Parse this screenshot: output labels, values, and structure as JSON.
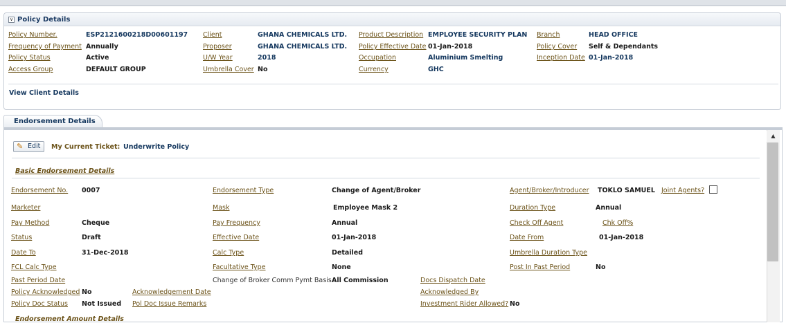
{
  "policy": {
    "title": "Policy Details",
    "labels": {
      "number": "Policy Number.",
      "frequency": "Frequency of Payment",
      "status": "Policy Status",
      "access_group": "Access Group",
      "client": "Client",
      "proposer": "Proposer",
      "uw_year": "U/W Year",
      "umbrella_cover": "Umbrella Cover",
      "product": "Product Description",
      "effective_date": "Policy Effective Date",
      "occupation": "Occupation",
      "currency": "Currency",
      "branch": "Branch",
      "cover": "Policy Cover",
      "inception": "Inception Date"
    },
    "values": {
      "number": "ESP2121600218D00601197",
      "frequency": "Annually",
      "status": "Active",
      "access_group": "DEFAULT GROUP",
      "client": "GHANA CHEMICALS LTD.",
      "proposer": "GHANA CHEMICALS LTD.",
      "uw_year": "2018",
      "umbrella_cover": "No",
      "product": "EMPLOYEE SECURITY PLAN",
      "effective_date": "01-Jan-2018",
      "occupation": "Aluminium Smelting",
      "currency": "GHC",
      "branch": "HEAD OFFICE",
      "cover": "Self & Dependants",
      "inception": "01-Jan-2018"
    },
    "view_client_link": "View Client Details"
  },
  "tabs": {
    "endorsement": "Endorsement Details"
  },
  "toolbar": {
    "edit_label": "Edit",
    "ticket_label": "My Current Ticket:",
    "ticket_value": "Underwrite Policy"
  },
  "basic": {
    "title": "Basic Endorsement Details",
    "labels": {
      "endorsement_no": "Endorsement No.",
      "marketer": "Marketer",
      "pay_method": "Pay Method",
      "status": "Status",
      "date_to": "Date To",
      "fcl_calc": "FCL Calc Type",
      "past_period": "Past Period Date",
      "policy_ack": "Policy Acknowledged",
      "policy_doc": "Policy Doc Status",
      "ack_date": "Acknowledgement Date",
      "pol_doc_remarks": "Pol Doc Issue Remarks",
      "endorsement_type": "Endorsement Type",
      "mask": "Mask",
      "pay_frequency": "Pay Frequency",
      "effective_date": "Effective Date",
      "calc_type": "Calc Type",
      "facultative": "Facultative Type",
      "broker_comm": "Change of Broker Comm Pymt Basis",
      "docs_dispatch": "Docs Dispatch Date",
      "ack_by": "Acknowledged By",
      "investment_rider": "Investment Rider Allowed?",
      "agent": "Agent/Broker/Introducer",
      "joint_agents": "Joint Agents?",
      "duration_type": "Duration Type",
      "check_off_agent": "Check Off Agent",
      "chk_off": "Chk Off%",
      "date_from": "Date From",
      "umbrella_duration": "Umbrella Duration Type",
      "post_in_past": "Post In Past Period"
    },
    "values": {
      "endorsement_no": "0007",
      "pay_method": "Cheque",
      "status": "Draft",
      "date_to": "31-Dec-2018",
      "policy_ack": "No",
      "policy_doc": "Not Issued",
      "endorsement_type": "Change of Agent/Broker",
      "mask": "Employee Mask 2",
      "pay_frequency": "Annual",
      "effective_date": "01-Jan-2018",
      "calc_type": "Detailed",
      "facultative": "None",
      "broker_comm": "All Commission",
      "investment_rider": "No",
      "agent": "TOKLO SAMUEL",
      "duration_type": "Annual",
      "date_from": "01-Jan-2018",
      "post_in_past": "No"
    }
  },
  "amount_section": {
    "title": "Endorsement Amount Details"
  },
  "colors": {
    "label_brown": "#6b5218",
    "value_blue": "#14375e",
    "border": "#c5ccd6"
  }
}
